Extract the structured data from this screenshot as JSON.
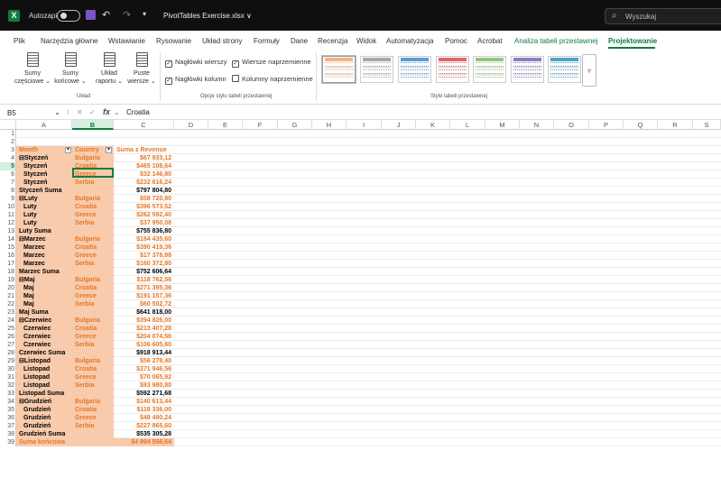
{
  "titlebar": {
    "app_letter": "X",
    "autosave": "Autozapis",
    "qat_more": "▾",
    "undo": "↶",
    "redo": "↷",
    "filename": "PivotTables Exercise.xlsx ∨",
    "search_placeholder": "Wyszukaj",
    "search_icon": "⌕"
  },
  "menu": {
    "items": [
      "Plik",
      "Narzędzia główne",
      "Wstawianie",
      "Rysowanie",
      "Układ strony",
      "Formuły",
      "Dane",
      "Recenzja",
      "Widok",
      "Automatyzacja",
      "Pomoc",
      "Acrobat"
    ],
    "context_tab": "Analiza tabeli przestawnej",
    "active_tab": "Projektowanie"
  },
  "ribbon": {
    "uklad": {
      "group": "Układ",
      "buttons": [
        {
          "l1": "Sumy",
          "l2": "częściowe ⌄"
        },
        {
          "l1": "Sumy",
          "l2": "końcowe ⌄"
        },
        {
          "l1": "Układ",
          "l2": "raportu ⌄"
        },
        {
          "l1": "Puste",
          "l2": "wiersze ⌄"
        }
      ]
    },
    "opcje": {
      "group": "Opcje stylu tabeli przestawnej",
      "checks": [
        {
          "label": "Nagłówki wierszy",
          "checked": true
        },
        {
          "label": "Wiersze naprzemienne",
          "checked": true
        },
        {
          "label": "Nagłówki kolumn",
          "checked": true
        },
        {
          "label": "Kolumny naprzemienne",
          "checked": false
        }
      ]
    },
    "style": {
      "group": "Style tabeli przestawnej",
      "colors": [
        "#f4b183",
        "#a6a6a6",
        "#5b9bd5",
        "#e06666",
        "#93c47d",
        "#8e7cc3",
        "#4aa3c4"
      ],
      "more": "▿"
    }
  },
  "formula_bar": {
    "name_box": "B5",
    "cancel": "✕",
    "confirm": "✓",
    "fx": "fx",
    "value": "Croatia"
  },
  "columns": [
    "A",
    "B",
    "C",
    "D",
    "E",
    "F",
    "G",
    "H",
    "I",
    "J",
    "K",
    "L",
    "M",
    "N",
    "O",
    "P",
    "Q",
    "R",
    "S"
  ],
  "rows": [
    {
      "n": "1",
      "a": "",
      "b": "",
      "c": "",
      "t": "empty"
    },
    {
      "n": "2",
      "a": "",
      "b": "",
      "c": "",
      "t": "empty"
    },
    {
      "n": "3",
      "a": "Month",
      "b": "Country",
      "c": "Suma z Revenue",
      "t": "header"
    },
    {
      "n": "4",
      "a": "⊟Styczeń",
      "b": "Bulgaria",
      "c": "$67 933,12",
      "t": "data"
    },
    {
      "n": "5",
      "a": "Styczeń",
      "b": "Croatia",
      "c": "$465 108,64",
      "t": "data"
    },
    {
      "n": "6",
      "a": "Styczeń",
      "b": "Greece",
      "c": "$32 146,80",
      "t": "data"
    },
    {
      "n": "7",
      "a": "Styczeń",
      "b": "Serbia",
      "c": "$232 616,24",
      "t": "data"
    },
    {
      "n": "8",
      "a": "Styczeń Suma",
      "b": "",
      "c": "$797 804,80",
      "t": "sub"
    },
    {
      "n": "9",
      "a": "⊟Luty",
      "b": "Bulgaria",
      "c": "$58 720,80",
      "t": "data"
    },
    {
      "n": "10",
      "a": "Luty",
      "b": "Croatia",
      "c": "$396 573,52",
      "t": "data"
    },
    {
      "n": "11",
      "a": "Luty",
      "b": "Greece",
      "c": "$262 592,40",
      "t": "data"
    },
    {
      "n": "12",
      "a": "Luty",
      "b": "Serbia",
      "c": "$37 950,08",
      "t": "data"
    },
    {
      "n": "13",
      "a": "Luty Suma",
      "b": "",
      "c": "$755 836,80",
      "t": "sub"
    },
    {
      "n": "14",
      "a": "⊟Marzec",
      "b": "Bulgaria",
      "c": "$184 435,60",
      "t": "data"
    },
    {
      "n": "15",
      "a": "Marzec",
      "b": "Croatia",
      "c": "$390 419,36",
      "t": "data"
    },
    {
      "n": "16",
      "a": "Marzec",
      "b": "Greece",
      "c": "$17 378,88",
      "t": "data"
    },
    {
      "n": "17",
      "a": "Marzec",
      "b": "Serbia",
      "c": "$160 372,80",
      "t": "data"
    },
    {
      "n": "18",
      "a": "Marzec Suma",
      "b": "",
      "c": "$752 606,64",
      "t": "sub"
    },
    {
      "n": "19",
      "a": "⊟Maj",
      "b": "Bulgaria",
      "c": "$118 762,56",
      "t": "data"
    },
    {
      "n": "20",
      "a": "Maj",
      "b": "Croatia",
      "c": "$271 395,36",
      "t": "data"
    },
    {
      "n": "21",
      "a": "Maj",
      "b": "Greece",
      "c": "$191 157,36",
      "t": "data"
    },
    {
      "n": "22",
      "a": "Maj",
      "b": "Serbia",
      "c": "$60 502,72",
      "t": "data"
    },
    {
      "n": "23",
      "a": "Maj Suma",
      "b": "",
      "c": "$641 818,00",
      "t": "sub"
    },
    {
      "n": "24",
      "a": "⊟Czerwiec",
      "b": "Bulgaria",
      "c": "$394 826,00",
      "t": "data"
    },
    {
      "n": "25",
      "a": "Czerwiec",
      "b": "Croatia",
      "c": "$213 407,28",
      "t": "data"
    },
    {
      "n": "26",
      "a": "Czerwiec",
      "b": "Greece",
      "c": "$204 074,56",
      "t": "data"
    },
    {
      "n": "27",
      "a": "Czerwiec",
      "b": "Serbia",
      "c": "$106 605,60",
      "t": "data"
    },
    {
      "n": "28",
      "a": "Czerwiec Suma",
      "b": "",
      "c": "$918 913,44",
      "t": "sub"
    },
    {
      "n": "29",
      "a": "⊟Listopad",
      "b": "Bulgaria",
      "c": "$56 278,40",
      "t": "data"
    },
    {
      "n": "30",
      "a": "Listopad",
      "b": "Croatia",
      "c": "$371 946,56",
      "t": "data"
    },
    {
      "n": "31",
      "a": "Listopad",
      "b": "Greece",
      "c": "$70 065,92",
      "t": "data"
    },
    {
      "n": "32",
      "a": "Listopad",
      "b": "Serbia",
      "c": "$93 980,80",
      "t": "data"
    },
    {
      "n": "33",
      "a": "Listopad Suma",
      "b": "",
      "c": "$592 271,68",
      "t": "sub"
    },
    {
      "n": "34",
      "a": "⊟Grudzień",
      "b": "Bulgaria",
      "c": "$140 613,44",
      "t": "data"
    },
    {
      "n": "35",
      "a": "Grudzień",
      "b": "Croatia",
      "c": "$118 336,00",
      "t": "data"
    },
    {
      "n": "36",
      "a": "Grudzień",
      "b": "Greece",
      "c": "$48 490,24",
      "t": "data"
    },
    {
      "n": "37",
      "a": "Grudzień",
      "b": "Serbia",
      "c": "$227 865,60",
      "t": "data"
    },
    {
      "n": "38",
      "a": "Grudzień Suma",
      "b": "",
      "c": "$535 305,28",
      "t": "sub"
    },
    {
      "n": "39",
      "a": "Suma końcowa",
      "b": "",
      "c": "$4 994 556,64",
      "t": "grand"
    }
  ]
}
